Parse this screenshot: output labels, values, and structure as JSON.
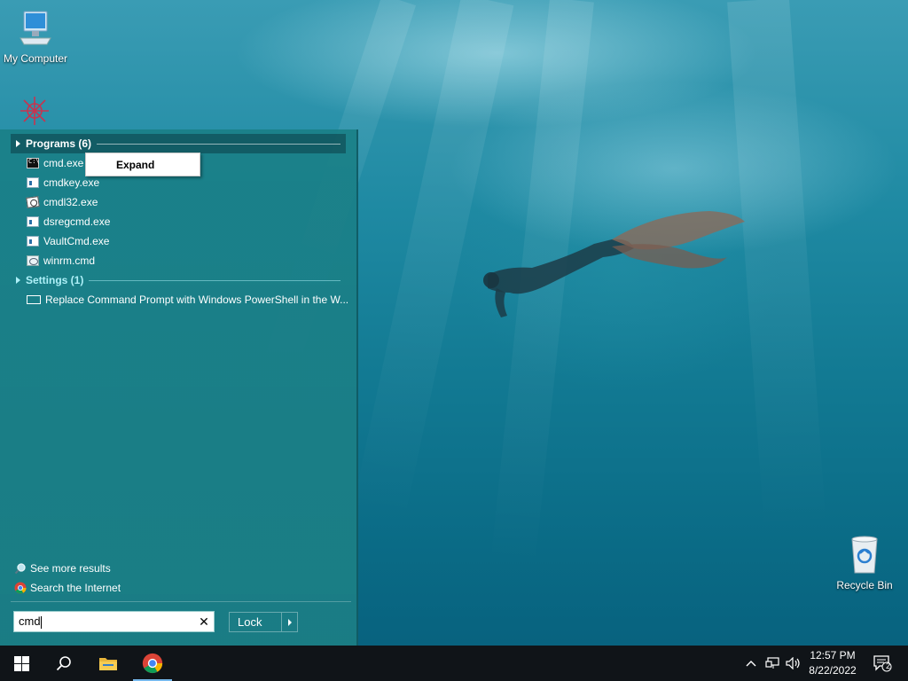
{
  "desktop": {
    "my_computer_label": "My Computer",
    "recycle_bin_label": "Recycle Bin"
  },
  "start_menu": {
    "programs_header": "Programs (6)",
    "programs": [
      {
        "label": "cmd.exe",
        "icon": "cmd-icon"
      },
      {
        "label": "cmdkey.exe",
        "icon": "app-window-icon"
      },
      {
        "label": "cmdl32.exe",
        "icon": "certificate-icon"
      },
      {
        "label": "dsregcmd.exe",
        "icon": "app-window-icon"
      },
      {
        "label": "VaultCmd.exe",
        "icon": "app-window-icon"
      },
      {
        "label": "winrm.cmd",
        "icon": "script-icon"
      }
    ],
    "settings_header": "Settings (1)",
    "settings": [
      {
        "label": "Replace Command Prompt with Windows PowerShell in the W...",
        "icon": "monitor-icon"
      }
    ],
    "see_more": "See more results",
    "search_internet": "Search the Internet",
    "search_value": "cmd",
    "lock_label": "Lock"
  },
  "context_menu": {
    "expand_label": "Expand"
  },
  "taskbar": {
    "time": "12:57 PM",
    "date": "8/22/2022",
    "notification_count": "2"
  },
  "colors": {
    "menu_bg": "#1b7e85",
    "taskbar_bg": "#101418",
    "accent": "#76b9ed"
  }
}
